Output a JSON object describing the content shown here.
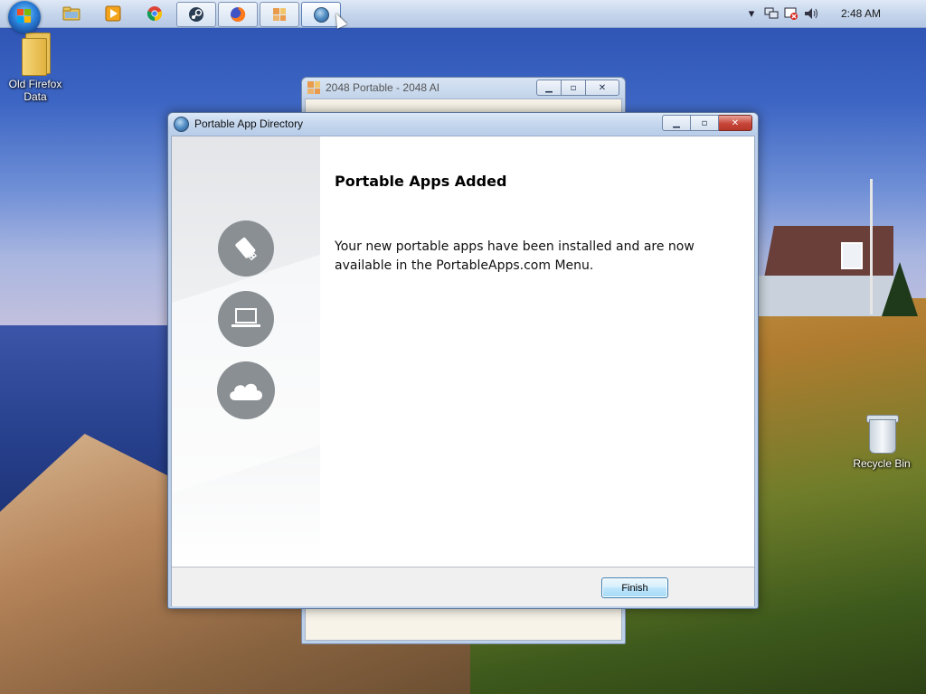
{
  "taskbar": {
    "start_label": "Start",
    "clock": "2:48 AM",
    "apps": [
      {
        "name": "file-explorer",
        "icon": "folder-icon"
      },
      {
        "name": "media-player",
        "icon": "play-icon"
      },
      {
        "name": "chrome",
        "icon": "chrome-icon"
      },
      {
        "name": "steam",
        "icon": "steam-icon"
      },
      {
        "name": "firefox",
        "icon": "firefox-icon"
      },
      {
        "name": "2048-portable",
        "icon": "2048-icon"
      },
      {
        "name": "portable-app-directory",
        "icon": "globe-icon"
      }
    ],
    "tray_icons": [
      "chevron-up-icon",
      "network-icon",
      "action-center-icon",
      "volume-icon"
    ]
  },
  "desktop": {
    "icons": [
      {
        "label": "Old Firefox Data",
        "icon": "folder-icon"
      },
      {
        "label": "Recycle Bin",
        "icon": "recycle-bin-icon"
      }
    ]
  },
  "background_window": {
    "title": "2048 Portable - 2048 AI"
  },
  "dialog": {
    "title": "Portable App Directory",
    "heading": "Portable Apps Added",
    "body": "Your new portable apps have been installed and are now available in the PortableApps.com Menu.",
    "finish_label": "Finish",
    "side_icons": [
      "usb-drive-icon",
      "laptop-icon",
      "cloud-icon"
    ]
  },
  "colors": {
    "accent": "#3c7fb1",
    "titlebar": "#c5d7ee",
    "close": "#c7463a"
  }
}
